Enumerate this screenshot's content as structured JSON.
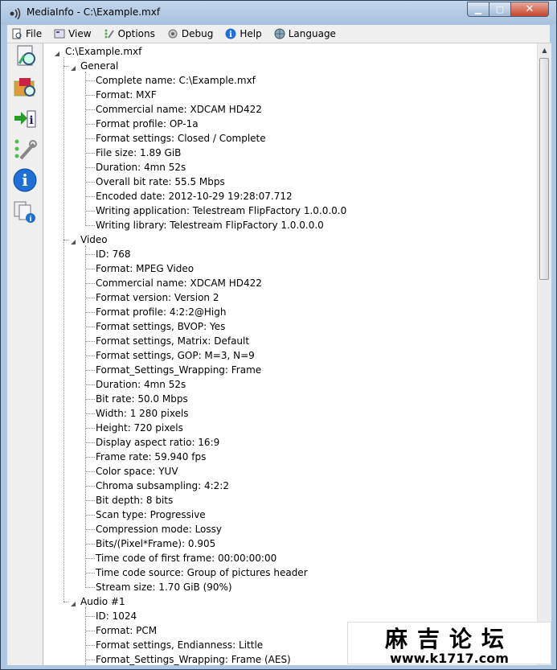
{
  "window": {
    "title": "MediaInfo - C:\\Example.mxf"
  },
  "menu": {
    "file": "File",
    "view": "View",
    "options": "Options",
    "debug": "Debug",
    "help": "Help",
    "language": "Language"
  },
  "tree": {
    "root": "C:\\Example.mxf",
    "sections": [
      {
        "name": "General",
        "items": [
          "Complete name: C:\\Example.mxf",
          "Format: MXF",
          "Commercial name: XDCAM HD422",
          "Format profile: OP-1a",
          "Format settings: Closed / Complete",
          "File size: 1.89 GiB",
          "Duration: 4mn 52s",
          "Overall bit rate: 55.5 Mbps",
          "Encoded date: 2012-10-29 19:28:07.712",
          "Writing application: Telestream FlipFactory 1.0.0.0.0",
          "Writing library: Telestream FlipFactory 1.0.0.0.0"
        ]
      },
      {
        "name": "Video",
        "items": [
          "ID: 768",
          "Format: MPEG Video",
          "Commercial name: XDCAM HD422",
          "Format version: Version 2",
          "Format profile: 4:2:2@High",
          "Format settings, BVOP: Yes",
          "Format settings, Matrix: Default",
          "Format settings, GOP: M=3, N=9",
          "Format_Settings_Wrapping: Frame",
          "Duration: 4mn 52s",
          "Bit rate: 50.0 Mbps",
          "Width: 1 280 pixels",
          "Height: 720 pixels",
          "Display aspect ratio: 16:9",
          "Frame rate: 59.940 fps",
          "Color space: YUV",
          "Chroma subsampling: 4:2:2",
          "Bit depth: 8 bits",
          "Scan type: Progressive",
          "Compression mode: Lossy",
          "Bits/(Pixel*Frame): 0.905",
          "Time code of first frame: 00:00:00:00",
          "Time code source: Group of pictures header",
          "Stream size: 1.70 GiB (90%)"
        ]
      },
      {
        "name": "Audio #1",
        "items": [
          "ID: 1024",
          "Format: PCM",
          "Format settings, Endianness: Little",
          "Format_Settings_Wrapping: Frame (AES)"
        ]
      }
    ]
  },
  "watermark": {
    "line1": "麻吉论坛",
    "line2": "www.k1717.com"
  },
  "icons": {
    "app": "mediainfo-app-icon",
    "toolbar": [
      "open-file-icon",
      "open-folder-icon",
      "export-icon",
      "preferences-icon",
      "info-icon",
      "about-icon"
    ]
  },
  "colors": {
    "title_bar": "#a7c1de",
    "close_button": "#c7452e",
    "info_blue": "#1f6fd6"
  }
}
